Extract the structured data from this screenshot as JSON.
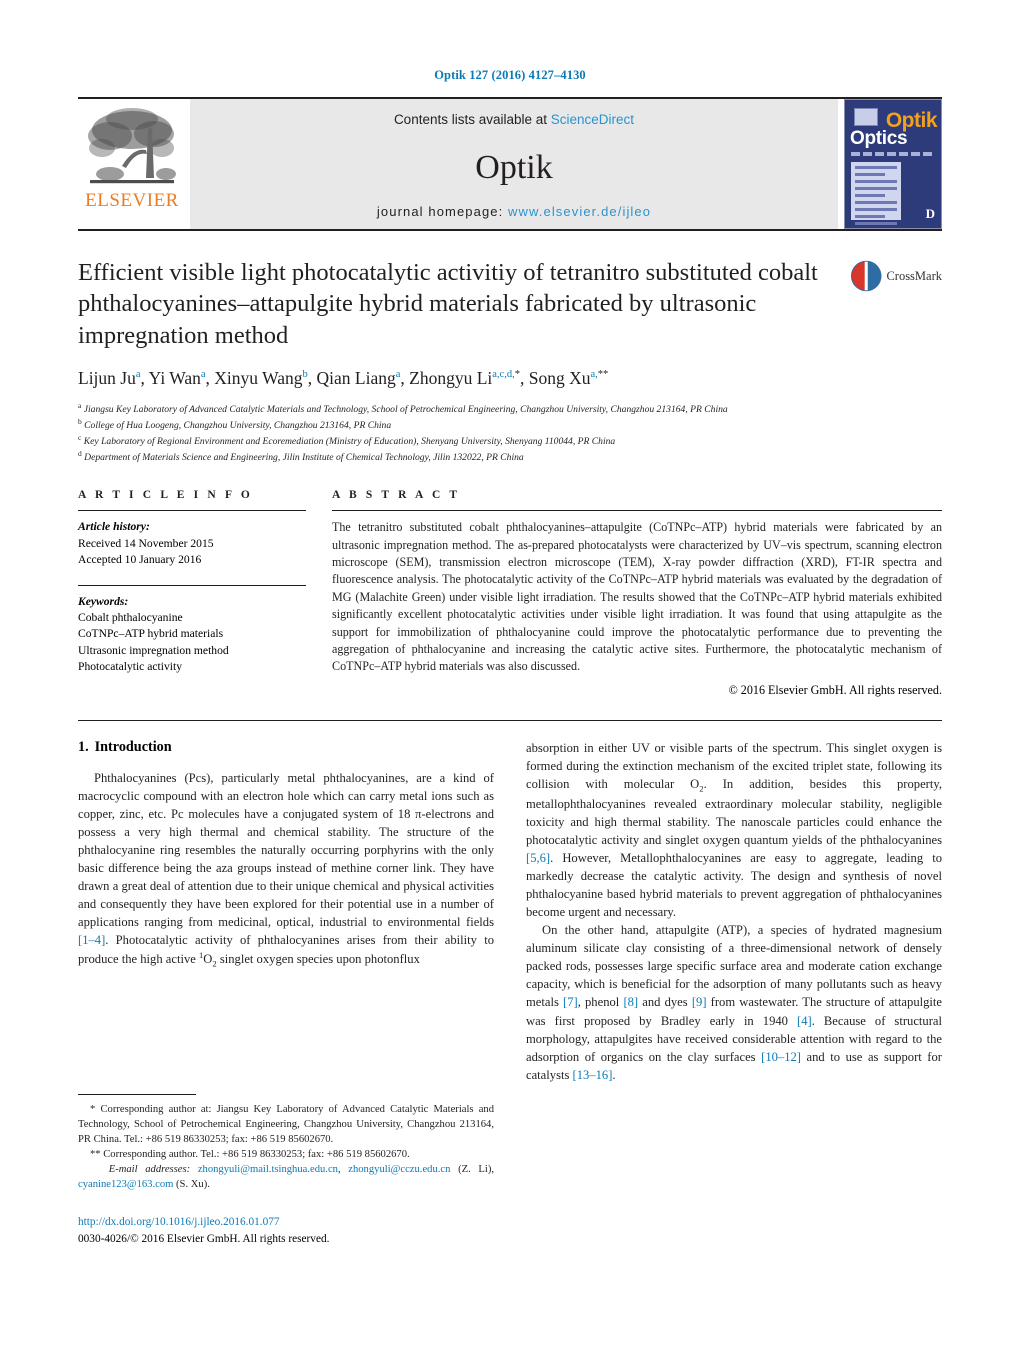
{
  "running_head": "Optik 127 (2016) 4127–4130",
  "masthead": {
    "contents_prefix": "Contents lists available at ",
    "sciencedirect": "ScienceDirect",
    "journal_name": "Optik",
    "homepage_prefix": "journal homepage:",
    "homepage_url": "www.elsevier.de/ijleo",
    "publisher_logo_text": "ELSEVIER",
    "cover": {
      "title_primary": "Optik",
      "title_secondary": "Optics",
      "publisher_mark": "D"
    }
  },
  "article": {
    "title": "Efficient visible light photocatalytic activitiy of tetranitro substituted cobalt phthalocyanines–attapulgite hybrid materials fabricated by ultrasonic impregnation method",
    "crossmark_label": "CrossMark",
    "authors": [
      {
        "name": "Lijun Ju",
        "sup": "a",
        "sep": ", "
      },
      {
        "name": "Yi Wan",
        "sup": "a",
        "sep": ", "
      },
      {
        "name": "Xinyu Wang",
        "sup": "b",
        "sep": ", "
      },
      {
        "name": "Qian Liang",
        "sup": "a",
        "sep": ", "
      },
      {
        "name": "Zhongyu Li",
        "sup": "a,c,d,",
        "star": "*",
        "sep": ", "
      },
      {
        "name": "Song Xu",
        "sup": "a,",
        "star": "**",
        "sep": ""
      }
    ],
    "affiliations": [
      {
        "mark": "a",
        "text": "Jiangsu Key Laboratory of Advanced Catalytic Materials and Technology, School of Petrochemical Engineering, Changzhou University, Changzhou 213164, PR China"
      },
      {
        "mark": "b",
        "text": "College of Hua Loogeng, Changzhou University, Changzhou 213164, PR China"
      },
      {
        "mark": "c",
        "text": "Key Laboratory of Regional Environment and Ecoremediation (Ministry of Education), Shenyang University, Shenyang 110044, PR China"
      },
      {
        "mark": "d",
        "text": "Department of Materials Science and Engineering, Jilin Institute of Chemical Technology, Jilin 132022, PR China"
      }
    ]
  },
  "article_info": {
    "heading": "A R T I C L E   I N F O",
    "history_label": "Article history:",
    "history": [
      "Received 14 November 2015",
      "Accepted 10 January 2016"
    ],
    "keywords_label": "Keywords:",
    "keywords": [
      "Cobalt phthalocyanine",
      "CoTNPc–ATP hybrid materials",
      "Ultrasonic impregnation method",
      "Photocatalytic activity"
    ]
  },
  "abstract": {
    "heading": "A B S T R A C T",
    "text": "The tetranitro substituted cobalt phthalocyanines–attapulgite (CoTNPc–ATP) hybrid materials were fabricated by an ultrasonic impregnation method. The as-prepared photocatalysts were characterized by UV–vis spectrum, scanning electron microscope (SEM), transmission electron microscope (TEM), X-ray powder diffraction (XRD), FT-IR spectra and fluorescence analysis. The photocatalytic activity of the CoTNPc–ATP hybrid materials was evaluated by the degradation of MG (Malachite Green) under visible light irradiation. The results showed that the CoTNPc–ATP hybrid materials exhibited significantly excellent photocatalytic activities under visible light irradiation. It was found that using attapulgite as the support for immobilization of phthalocyanine could improve the photocatalytic performance due to preventing the aggregation of phthalocyanine and increasing the catalytic active sites. Furthermore, the photocatalytic mechanism of CoTNPc–ATP hybrid materials was also discussed.",
    "copyright": "© 2016 Elsevier GmbH. All rights reserved."
  },
  "body": {
    "section_number": "1.",
    "section_title": "Introduction",
    "left_para_1_a": "Phthalocyanines (Pcs), particularly metal phthalocyanines, are a kind of macrocyclic compound with an electron hole which can carry metal ions such as copper, zinc, etc. Pc molecules have a conjugated system of 18 π-electrons and possess a very high thermal and chemical stability. The structure of the phthalocyanine ring resembles the naturally occurring porphyrins with the only basic difference being the aza groups instead of methine corner link. They have drawn a great deal of attention due to their unique chemical and physical activities and consequently they have been explored for their potential use in a number of applications ranging from medicinal, optical, industrial to environmental fields ",
    "ref_1_4": "[1–4]",
    "left_para_1_b": ". Photocatalytic activity of phthalocyanines arises from their ability to produce the high active ",
    "singlet_sup": "1",
    "singlet_o": "O",
    "singlet_sub": "2",
    "left_para_1_c": " singlet oxygen species upon photonflux",
    "right_para_1_a": "absorption in either UV or visible parts of the spectrum. This singlet oxygen is formed during the extinction mechanism of the excited triplet state, following its collision with molecular O",
    "o2_sub": "2",
    "right_para_1_b": ". In addition, besides this property, metallophthalocyanines revealed extraordinary molecular stability, negligible toxicity and high thermal stability. The nanoscale particles could enhance the photocatalytic activity and singlet oxygen quantum yields of the phthalocyanines ",
    "ref_5_6": "[5,6]",
    "right_para_1_c": ". However, Metallophthalocyanines are easy to aggregate, leading to markedly decrease the catalytic activity. The design and synthesis of novel phthalocyanine based hybrid materials to prevent aggregation of phthalocyanines become urgent and necessary.",
    "right_para_2_a": "On the other hand, attapulgite (ATP), a species of hydrated magnesium aluminum silicate clay consisting of a three-dimensional network of densely packed rods, possesses large specific surface area and moderate cation exchange capacity, which is beneficial for the adsorption of many pollutants such as heavy metals ",
    "ref_7": "[7]",
    "right_para_2_b": ", phenol ",
    "ref_8": "[8]",
    "right_para_2_c": " and dyes ",
    "ref_9": "[9]",
    "right_para_2_d": " from wastewater. The structure of attapulgite was first proposed by Bradley early in 1940 ",
    "ref_4": "[4]",
    "right_para_2_e": ". Because of structural morphology, attapulgites have received considerable attention with regard to the adsorption of organics on the clay surfaces ",
    "ref_10_12": "[10–12]",
    "right_para_2_f": " and to use as support for catalysts ",
    "ref_13_16": "[13–16]",
    "right_para_2_g": "."
  },
  "footnotes": {
    "corr_1": "* Corresponding author at: Jiangsu Key Laboratory of Advanced Catalytic Materials and Technology, School of Petrochemical Engineering, Changzhou University, Changzhou 213164, PR China. Tel.: +86 519 86330253; fax: +86 519 85602670.",
    "corr_2": "** Corresponding author. Tel.: +86 519 86330253; fax: +86 519 85602670.",
    "email_label": "E-mail addresses:",
    "email_1": "zhongyuli@mail.tsinghua.edu.cn",
    "email_2": "zhongyuli@cczu.edu.cn",
    "email_1_owner": "(Z. Li),",
    "email_3": "cyanine123@163.com",
    "email_3_owner": "(S. Xu).",
    "doi_url": "http://dx.doi.org/10.1016/j.ijleo.2016.01.077",
    "issn_line": "0030-4026/© 2016 Elsevier GmbH. All rights reserved."
  }
}
